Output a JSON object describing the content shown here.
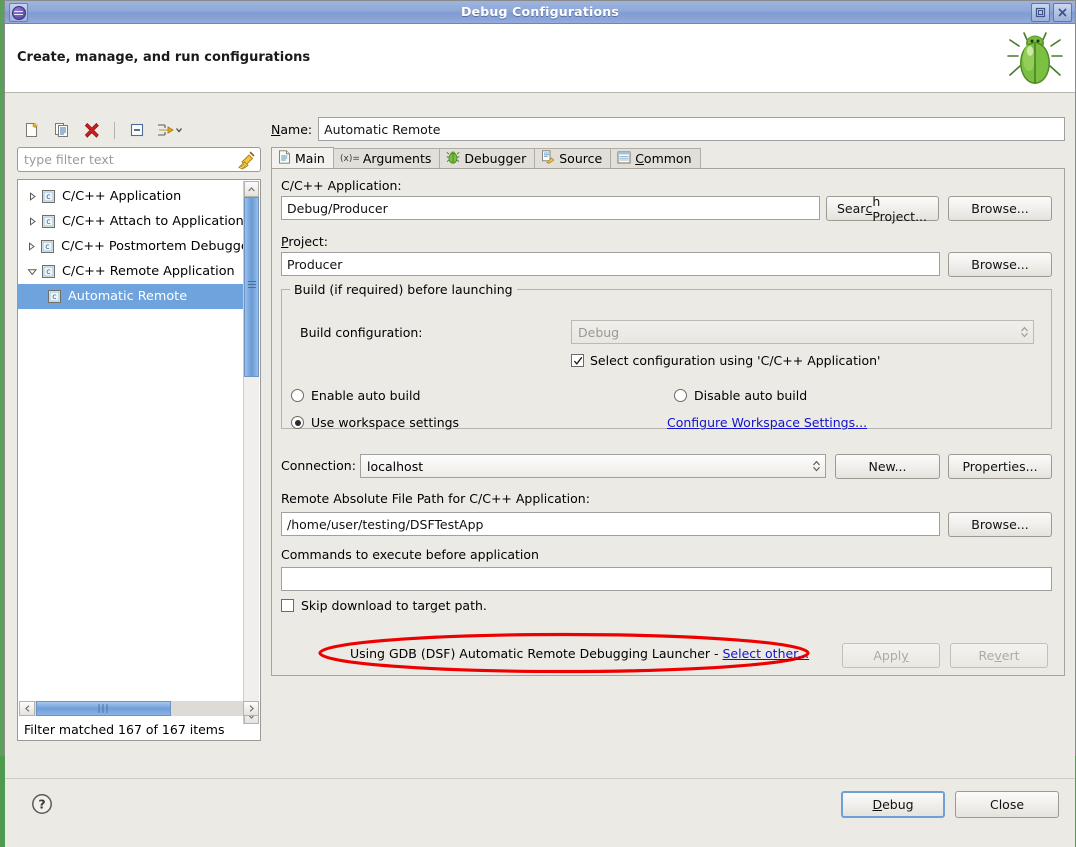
{
  "window": {
    "title": "Debug Configurations",
    "app_icon": "eclipse-icon",
    "maximize_label": "maximize-icon",
    "close_label": "close-icon"
  },
  "header": {
    "title": "Create, manage, and run configurations",
    "banner_icon": "bug-icon"
  },
  "toolbar": {
    "items": [
      {
        "name": "new-launch-configuration-icon",
        "tooltip": "New launch configuration"
      },
      {
        "name": "duplicate-icon",
        "tooltip": "Duplicate"
      },
      {
        "name": "delete-icon",
        "tooltip": "Delete"
      },
      {
        "name": "collapse-all-icon",
        "tooltip": "Collapse All"
      },
      {
        "name": "filter-launch-configurations-icon",
        "tooltip": "Filter launch configurations"
      }
    ]
  },
  "filter": {
    "placeholder": "type filter text",
    "value": "",
    "clear_icon": "broom-icon",
    "status": "Filter matched 167 of 167 items"
  },
  "tree": {
    "items": [
      {
        "label": "C/C++ Application",
        "expanded": false,
        "has_children": true,
        "level": 0,
        "selected": false
      },
      {
        "label": "C/C++ Attach to Application",
        "expanded": false,
        "has_children": true,
        "level": 0,
        "selected": false
      },
      {
        "label": "C/C++ Postmortem Debugger",
        "expanded": false,
        "has_children": true,
        "level": 0,
        "selected": false
      },
      {
        "label": "C/C++ Remote Application",
        "expanded": true,
        "has_children": true,
        "level": 0,
        "selected": false
      },
      {
        "label": "Automatic Remote",
        "expanded": false,
        "has_children": false,
        "level": 1,
        "selected": true
      }
    ]
  },
  "config": {
    "name_label": "Name:",
    "name_label_mnemonic": "N",
    "name_value": "Automatic Remote",
    "tabs": [
      {
        "label": "Main",
        "icon": "document-icon",
        "active": true,
        "mnemonic": ""
      },
      {
        "label": "Arguments",
        "icon": "variables-icon",
        "active": false,
        "mnemonic": ""
      },
      {
        "label": "Debugger",
        "icon": "bug-small-icon",
        "active": false,
        "mnemonic": ""
      },
      {
        "label": "Source",
        "icon": "source-lookup-icon",
        "active": false,
        "mnemonic": ""
      },
      {
        "label": "Common",
        "icon": "common-icon",
        "active": false,
        "mnemonic": "C"
      }
    ],
    "app_label": "C/C++ Application:",
    "app_value": "Debug/Producer",
    "search_project_button": "Search Project...",
    "search_project_mnemonic": "c",
    "browse_button_1": "Browse...",
    "project_label": "Project:",
    "project_value": "Producer",
    "browse_button_2": "Browse...",
    "build_group_title": "Build (if required) before launching",
    "build_config_label": "Build configuration:",
    "build_config_value": "Debug",
    "build_config_disabled": true,
    "select_config_checkbox": "Select configuration using 'C/C++ Application'",
    "select_config_checked": true,
    "enable_auto_build": "Enable auto build",
    "enable_auto_build_selected": false,
    "disable_auto_build": "Disable auto build",
    "disable_auto_build_selected": false,
    "use_workspace_settings": "Use workspace settings",
    "use_workspace_settings_selected": true,
    "configure_workspace_link": "Configure Workspace Settings...",
    "connection_label": "Connection:",
    "connection_value": "localhost",
    "new_button": "New...",
    "properties_button": "Properties...",
    "remote_path_label": "Remote Absolute File Path for C/C++ Application:",
    "remote_path_value": "/home/user/testing/DSFTestApp",
    "browse_button_3": "Browse...",
    "commands_label": "Commands to execute before application",
    "commands_value": "",
    "skip_download_checkbox": "Skip download to target path.",
    "skip_download_checked": false
  },
  "launcher": {
    "prefix": "Using GDB (DSF) Automatic Remote Debugging Launcher - ",
    "link": "Select other...",
    "apply_button": "Apply",
    "apply_mnemonic": "y",
    "apply_disabled": true,
    "revert_button": "Revert",
    "revert_mnemonic": "v",
    "revert_disabled": true,
    "highlight_color": "#ee0000"
  },
  "footer": {
    "help_icon": "help-icon",
    "debug_button": "Debug",
    "debug_mnemonic": "D",
    "close_button": "Close"
  },
  "colors": {
    "titlebar": "#8fa8d8",
    "dialog_bg": "#eceae5",
    "selection": "#6ea3dd",
    "link": "#1414c8",
    "annotation": "#ee0000"
  }
}
